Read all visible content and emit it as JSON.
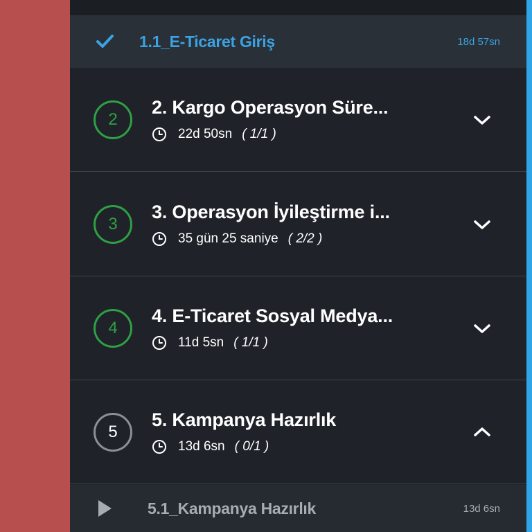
{
  "colors": {
    "side_red": "#b84f4f",
    "panel_bg": "#1f2329",
    "active_blue": "#3aa3e3",
    "complete_green": "#2ea043",
    "incomplete_gray": "#8b9097",
    "scroll_accent": "#2fa4e7"
  },
  "active_lesson": {
    "icon": "check-icon",
    "title": "1.1_E-Ticaret Giriş",
    "duration": "18d 57sn"
  },
  "sections": [
    {
      "number": "2",
      "title": "2. Kargo Operasyon Süre...",
      "duration": "22d 50sn",
      "progress": "( 1/1 )",
      "status": "complete",
      "chevron": "chevron-down-icon"
    },
    {
      "number": "3",
      "title": "3. Operasyon İyileştirme i...",
      "duration": "35 gün 25 saniye",
      "progress": "( 2/2 )",
      "status": "complete",
      "chevron": "chevron-down-icon"
    },
    {
      "number": "4",
      "title": "4. E-Ticaret Sosyal Medya...",
      "duration": "11d 5sn",
      "progress": "( 1/1 )",
      "status": "complete",
      "chevron": "chevron-down-icon"
    },
    {
      "number": "5",
      "title": "5. Kampanya Hazırlık",
      "duration": "13d 6sn",
      "progress": "( 0/1 )",
      "status": "incomplete",
      "chevron": "chevron-up-icon"
    }
  ],
  "pending_lesson": {
    "icon": "play-icon",
    "title": "5.1_Kampanya Hazırlık",
    "duration": "13d 6sn"
  }
}
